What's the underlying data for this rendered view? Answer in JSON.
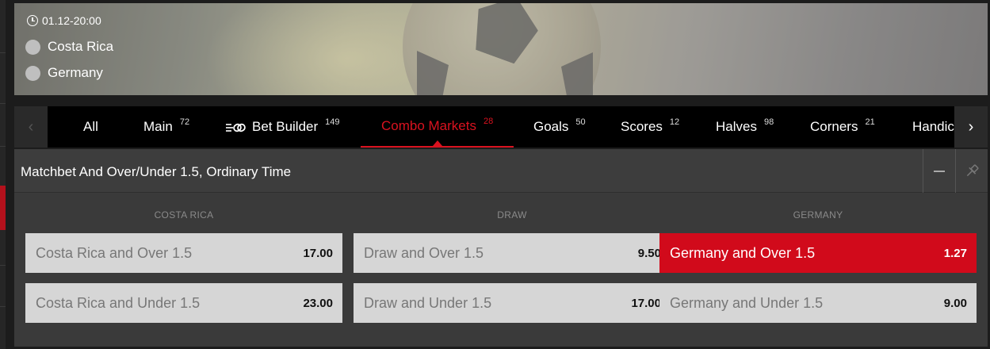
{
  "event": {
    "time": "01.12-20:00",
    "home_team": "Costa Rica",
    "away_team": "Germany"
  },
  "tabs": [
    {
      "label": "All",
      "count": ""
    },
    {
      "label": "Main",
      "count": "72"
    },
    {
      "label": "Bet Builder",
      "count": "149",
      "icon": "bet-builder-icon"
    },
    {
      "label": "Combo Markets",
      "count": "28",
      "active": true
    },
    {
      "label": "Goals",
      "count": "50"
    },
    {
      "label": "Scores",
      "count": "12"
    },
    {
      "label": "Halves",
      "count": "98"
    },
    {
      "label": "Corners",
      "count": "21"
    },
    {
      "label": "Handicap",
      "count": ""
    }
  ],
  "market": {
    "title": "Matchbet And Over/Under 1.5, Ordinary Time",
    "columns": [
      "COSTA RICA",
      "DRAW",
      "GERMANY"
    ],
    "rows": [
      [
        {
          "label": "Costa Rica and Over 1.5",
          "price": "17.00",
          "selected": false
        },
        {
          "label": "Draw and Over 1.5",
          "price": "9.50",
          "selected": false
        },
        {
          "label": "Germany and Over 1.5",
          "price": "1.27",
          "selected": true
        }
      ],
      [
        {
          "label": "Costa Rica and Under 1.5",
          "price": "23.00",
          "selected": false
        },
        {
          "label": "Draw and Under 1.5",
          "price": "17.00",
          "selected": false
        },
        {
          "label": "Germany and Under 1.5",
          "price": "9.00",
          "selected": false
        }
      ]
    ]
  },
  "colors": {
    "accent": "#d10a1b",
    "background": "#1c1c1c",
    "odd_button": "#d6d6d6"
  }
}
